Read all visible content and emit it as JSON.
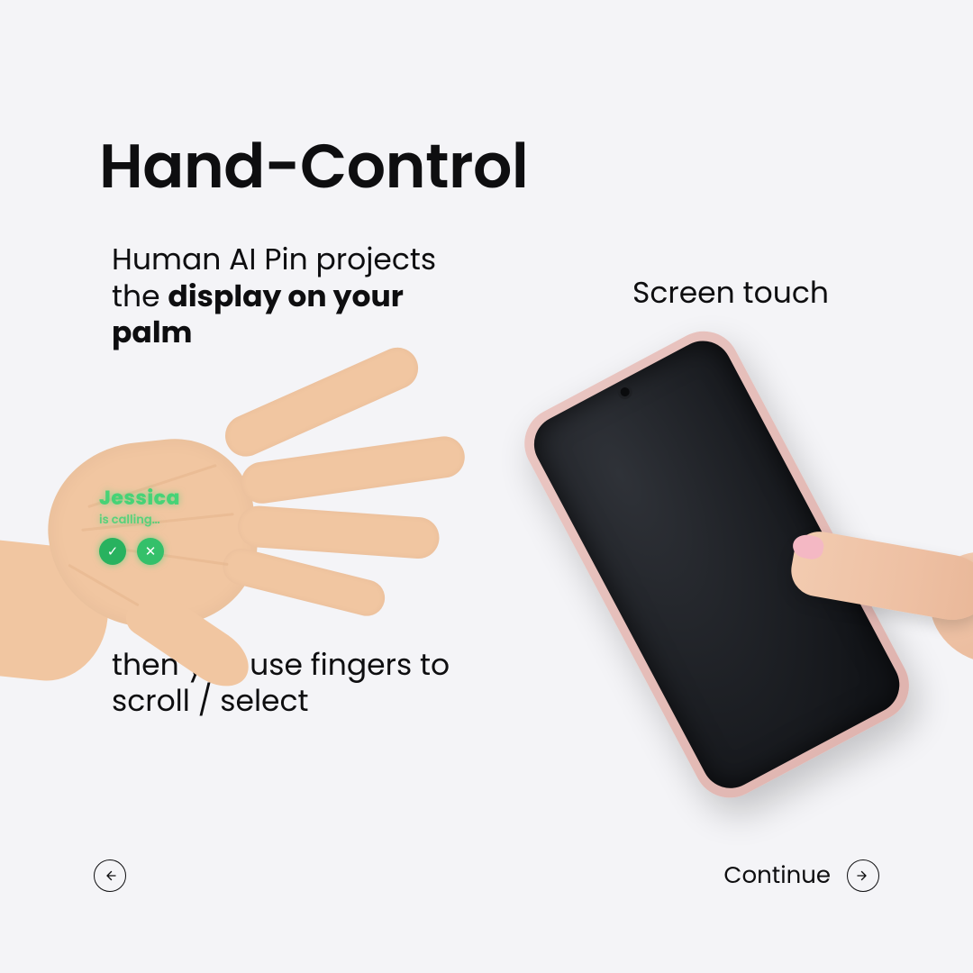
{
  "title": "Hand-Control",
  "left": {
    "intro_prefix": "Human AI Pin projects the ",
    "intro_bold": "display on your palm",
    "outro": "then you use fingers to scroll / select"
  },
  "right": {
    "caption": "Screen touch"
  },
  "projection": {
    "caller_name": "Jessica",
    "caller_status": "is calling…",
    "accept_glyph": "✓",
    "decline_glyph": "✕"
  },
  "nav": {
    "continue_label": "Continue"
  }
}
